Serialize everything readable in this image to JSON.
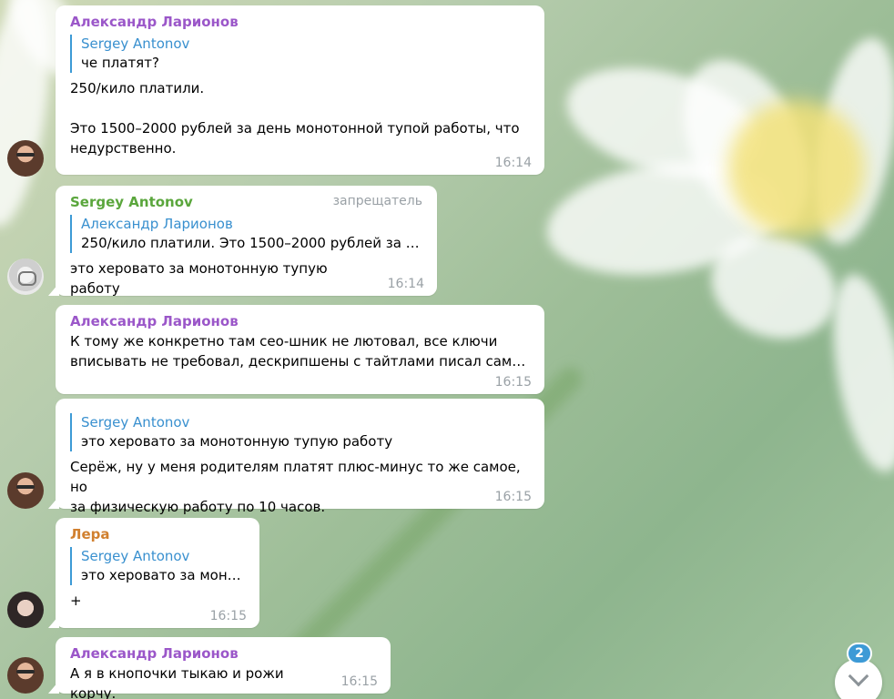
{
  "messages": [
    {
      "author": "Александр Ларионов",
      "quote": {
        "name": "Sergey Antonov",
        "text": "че платят?"
      },
      "text": "250/кило платили.\n\nЭто 1500–2000 рублей за день монотонной тупой работы, что\nнедурственно.",
      "time": "16:14"
    },
    {
      "author": "Sergey Antonov",
      "role": "запрещатель",
      "quote": {
        "name": "Александр Ларионов",
        "text": "250/кило платили.  Это 1500–2000 рублей за д…"
      },
      "text": "это херовато за монотонную тупую работу",
      "time": "16:14"
    },
    {
      "author": "Александр Ларионов",
      "text": "К тому же конкретно там сео-шник не лютовал, все ключи\nвписывать не требовал, дескрипшены с тайтлами писал сам…",
      "time": "16:15"
    },
    {
      "quote": {
        "name": "Sergey Antonov",
        "text": "это херовато за монотонную тупую работу"
      },
      "text": "Серёж, ну у меня родителям платят плюс-минус то же самое, но\nза физическую работу по 10 часов.",
      "time": "16:15"
    },
    {
      "author": "Лера",
      "quote": {
        "name": "Sergey Antonov",
        "text": "это херовато за моно…"
      },
      "text": "+",
      "time": "16:15"
    },
    {
      "author": "Александр Ларионов",
      "text": "А я в кнопочки тыкаю и рожи корчу.",
      "time": "16:15"
    }
  ],
  "unread_count": "2",
  "icons": {
    "scroll_down": "chevron-down-icon"
  }
}
